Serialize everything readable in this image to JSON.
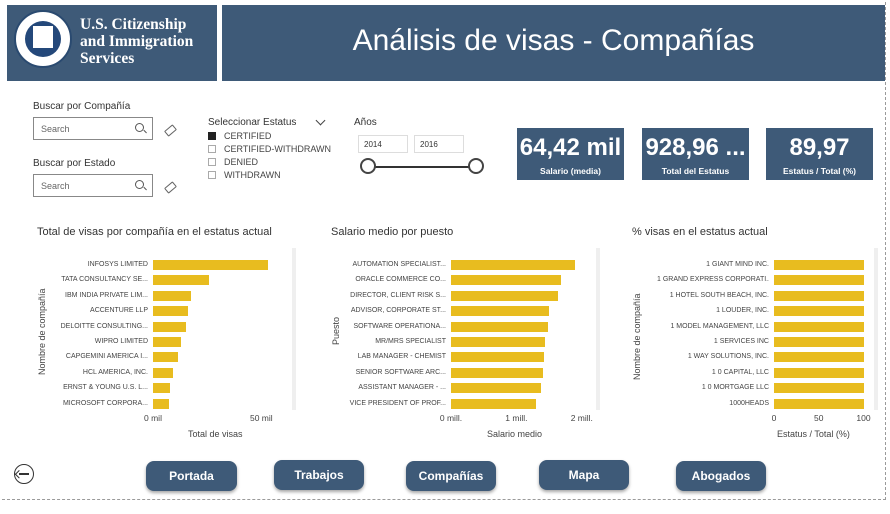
{
  "header": {
    "logo_lines": [
      "U.S. Citizenship",
      "and Immigration",
      "Services"
    ],
    "title": "Análisis de visas - Compañías"
  },
  "filters": {
    "company": {
      "label": "Buscar por Compañía",
      "placeholder": "Search"
    },
    "state": {
      "label": "Buscar por Estado",
      "placeholder": "Search"
    },
    "status": {
      "label": "Seleccionar Estatus",
      "options": [
        {
          "label": "CERTIFIED",
          "checked": true
        },
        {
          "label": "CERTIFIED-WITHDRAWN",
          "checked": false
        },
        {
          "label": "DENIED",
          "checked": false
        },
        {
          "label": "WITHDRAWN",
          "checked": false
        }
      ]
    },
    "years": {
      "label": "Años",
      "from": "2014",
      "to": "2016"
    }
  },
  "kpis": [
    {
      "value": "64,42 mil",
      "caption": "Salario (media)"
    },
    {
      "value": "928,96 ...",
      "caption": "Total del Estatus"
    },
    {
      "value": "89,97",
      "caption": "Estatus / Total (%)"
    }
  ],
  "colors": {
    "header": "#3e5a78",
    "bar": "#e8bc1f"
  },
  "chart_data": [
    {
      "type": "bar",
      "title": "Total de visas por compañía en el estatus actual",
      "xlabel": "Total de visas",
      "ylabel": "Nombre de compañía",
      "categories": [
        "INFOSYS LIMITED",
        "TATA CONSULTANCY SE...",
        "IBM INDIA PRIVATE LIM...",
        "ACCENTURE LLP",
        "DELOITTE CONSULTING...",
        "WIPRO LIMITED",
        "CAPGEMINI AMERICA I...",
        "HCL AMERICA, INC.",
        "ERNST & YOUNG U.S. L...",
        "MICROSOFT CORPORA..."
      ],
      "values": [
        53000,
        26000,
        17500,
        16000,
        15000,
        13000,
        11500,
        9000,
        8000,
        7500
      ],
      "xlim": [
        0,
        60000
      ],
      "xticks": [
        {
          "v": 0,
          "label": "0 mil"
        },
        {
          "v": 50000,
          "label": "50 mil"
        }
      ]
    },
    {
      "type": "bar",
      "title": "Salario medio por puesto",
      "xlabel": "Salario medio",
      "ylabel": "Puesto",
      "categories": [
        "AUTOMATION SPECIALIST...",
        "ORACLE COMMERCE CO...",
        "DIRECTOR, CLIENT RISK S...",
        "ADVISOR, CORPORATE ST...",
        "SOFTWARE OPERATIONA...",
        "MR/MRS SPECIALIST",
        "LAB MANAGER - CHEMIST",
        "SENIOR SOFTWARE ARC...",
        "ASSISTANT MANAGER - ...",
        "VICE PRESIDENT OF PROF..."
      ],
      "values": [
        1900000,
        1680000,
        1640000,
        1500000,
        1490000,
        1430000,
        1420000,
        1400000,
        1370000,
        1300000
      ],
      "xlim": [
        0,
        2400000
      ],
      "xticks": [
        {
          "v": 0,
          "label": "0 mill."
        },
        {
          "v": 1000000,
          "label": "1 mill."
        },
        {
          "v": 2000000,
          "label": "2 mill."
        }
      ]
    },
    {
      "type": "bar",
      "title": "% visas en el estatus actual",
      "xlabel": "Estatus / Total (%)",
      "ylabel": "Nombre de compañía",
      "categories": [
        "1 GIANT MIND INC.",
        "1 GRAND EXPRESS CORPORATI...",
        "1 HOTEL SOUTH BEACH, INC.",
        "1 LOUDER, INC.",
        "1 MODEL MANAGEMENT, LLC",
        "1 SERVICES INC",
        "1 WAY SOLUTIONS, INC.",
        "1 0 CAPITAL, LLC",
        "1 0 MORTGAGE LLC",
        "1000HEADS"
      ],
      "values": [
        100,
        100,
        100,
        100,
        100,
        100,
        100,
        100,
        100,
        100
      ],
      "xlim": [
        0,
        105
      ],
      "xticks": [
        {
          "v": 0,
          "label": "0"
        },
        {
          "v": 50,
          "label": "50"
        },
        {
          "v": 100,
          "label": "100"
        }
      ]
    }
  ],
  "nav": {
    "buttons": [
      "Portada",
      "Trabajos",
      "Compañías",
      "Mapa",
      "Abogados"
    ]
  }
}
